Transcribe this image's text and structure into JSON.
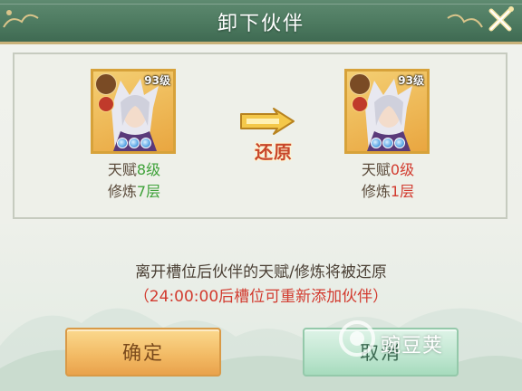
{
  "dialog": {
    "title": "卸下伙伴",
    "close_icon": "close-x-icon"
  },
  "before": {
    "level": "93级",
    "talent_prefix": "天赋",
    "talent_value": "8级",
    "cultivation_prefix": "修炼",
    "cultivation_value": "7层",
    "stars": 3
  },
  "after": {
    "level": "93级",
    "talent_prefix": "天赋",
    "talent_value": "0级",
    "cultivation_prefix": "修炼",
    "cultivation_value": "1层",
    "stars": 3
  },
  "transition": {
    "icon": "double-arrow-right-icon",
    "label": "还原"
  },
  "messages": {
    "line1": "离开槽位后伙伴的天赋/修炼将被还原",
    "line2": "（24:00:00后槽位可重新添加伙伴）"
  },
  "buttons": {
    "confirm": "确定",
    "cancel": "取消"
  },
  "watermark": {
    "text": "豌豆荚"
  },
  "colors": {
    "title_bar": "#4d7a60",
    "gain": "#3fa23a",
    "loss": "#d23b2f",
    "confirm_button": "#f2b963",
    "cancel_button": "#bfe6d0"
  }
}
